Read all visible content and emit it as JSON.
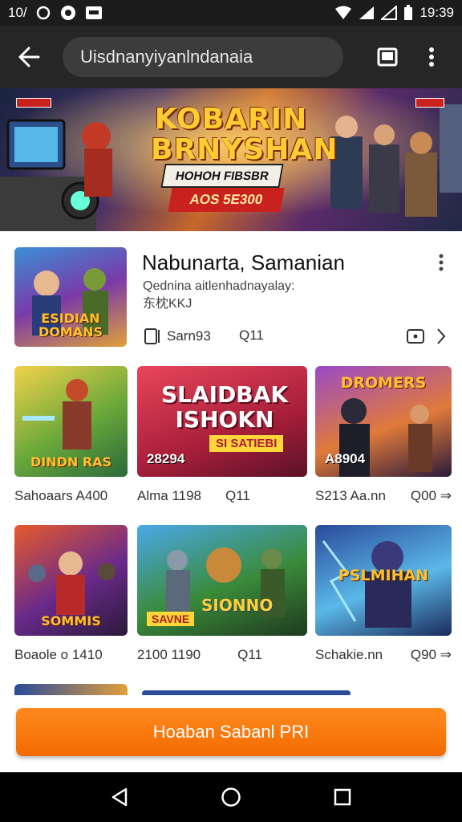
{
  "status_bar": {
    "left_text": "10/",
    "time": "19:39",
    "icons": [
      "circle-outline-icon",
      "record-icon",
      "cast-icon",
      "wifi-icon",
      "signal-icon",
      "battery-icon"
    ]
  },
  "app_bar": {
    "search_value": "Uisdnanyiyanlndanaia",
    "icons": [
      "back-arrow-icon",
      "tab-switch-icon",
      "more-vert-icon"
    ]
  },
  "banner": {
    "title": "KOBARIN BRNYSHAN",
    "ribbon_top": "HOHOH FIBSBR",
    "ribbon_bottom": "AOS 5E300",
    "badge_left": "",
    "badge_right": ""
  },
  "featured": {
    "thumb_label": "ESIDIAN DOMANS",
    "title": "Nabunarta, Samanian",
    "desc_line1": "Qednina aitlenhadnayalay:",
    "desc_line2": "东枕KKJ",
    "meta_left": "Sarn93",
    "meta_right": "Q11"
  },
  "grid": {
    "cards": [
      {
        "thumb": "DINDN RAS",
        "overlay": "",
        "caption_left": "Sahoaars A400",
        "caption_right": ""
      },
      {
        "thumb": "SLAIDBAK ISHOKN",
        "sub": "SI SATIEBI",
        "overlay": "28294",
        "caption_left": "Alma 1198",
        "caption_right": "Q11"
      },
      {
        "thumb": "DROMERS",
        "overlay": "A8904",
        "caption_left": "S213 Aa.nn",
        "caption_right": "Q00 ⇒"
      },
      {
        "thumb": "SOMMIS",
        "overlay": "",
        "caption_left": "Boaole o 1410",
        "caption_right": ""
      },
      {
        "thumb": "SIONNO",
        "sub": "SAVNE",
        "overlay": "",
        "caption_left": "2100 1190",
        "caption_right": "Q11"
      },
      {
        "thumb": "PSLMIHAN",
        "overlay": "",
        "caption_left": "Schakie.nn",
        "caption_right": "Q90 ⇒"
      }
    ]
  },
  "cta": {
    "label": "Hoaban Sabanl PRI"
  },
  "nav_bar": {
    "icons": [
      "back-triangle-icon",
      "home-circle-icon",
      "recents-square-icon"
    ]
  }
}
